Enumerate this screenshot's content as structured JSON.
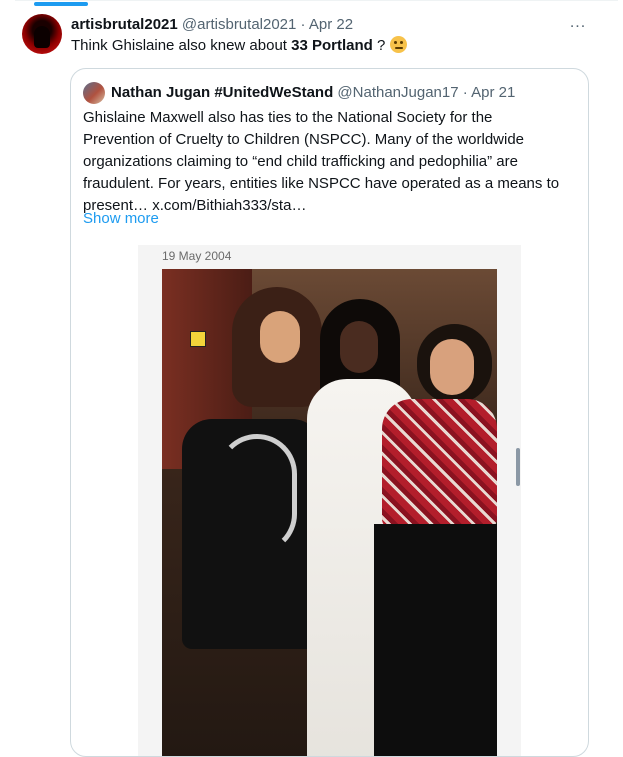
{
  "tweet": {
    "author_name": "artisbrutal2021",
    "author_handle": "@artisbrutal2021",
    "date": "Apr 22",
    "text_before": "Think Ghislaine also knew about ",
    "text_bold": "33 Portland",
    "text_after": " ?",
    "more_icon": "..."
  },
  "quoted_tweet": {
    "author_name": "Nathan Jugan #UnitedWeStand",
    "author_handle": "@NathanJugan17",
    "date": "Apr 21",
    "line1": "Ghislaine Maxwell also has ties to the National Society for the",
    "line2": "Prevention of Cruelty to Children (NSPCC). Many of the worldwide",
    "line3": "organizations claiming to “end child trafficking and pedophilia” are",
    "line4": "fraudulent. For years, entities like NSPCC have operated as a means to",
    "line5": "present…  x.com/Bithiah333/sta…",
    "show_more": "Show more",
    "media_caption": "19 May 2004"
  },
  "colors": {
    "accent": "#1d9bf0",
    "text": "#0f1419",
    "secondary_text": "#536471",
    "border": "#cfd9de"
  }
}
